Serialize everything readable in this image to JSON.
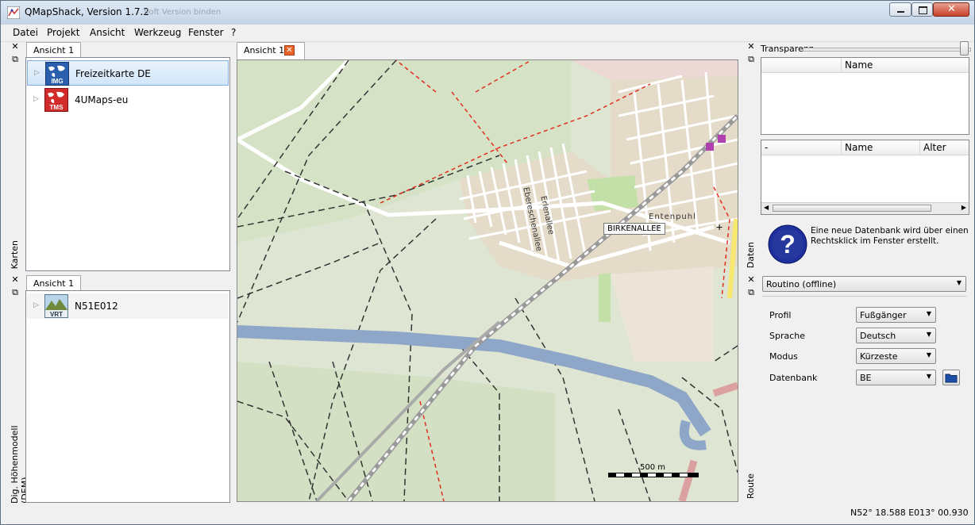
{
  "window": {
    "title": "QMapShack, Version 1.7.2",
    "ghost_title": "Soft Version binden"
  },
  "menu": [
    "Datei",
    "Projekt",
    "Ansicht",
    "Werkzeug",
    "Fenster",
    "?"
  ],
  "left_docks": {
    "maps": {
      "side_label": "Karten",
      "tab": "Ansicht 1",
      "items": [
        {
          "label": "Freizeitkarte DE",
          "badge": "IMG",
          "selected": true
        },
        {
          "label": "4UMaps-eu",
          "badge": "TMS",
          "selected": false
        }
      ]
    },
    "dem": {
      "side_label": "Dig. Höhenmodell (DEM)",
      "tab": "Ansicht 1",
      "items": [
        {
          "label": "N51E012",
          "badge": "VRT"
        }
      ]
    }
  },
  "map": {
    "tab": "Ansicht 1",
    "labels": {
      "street_tooltip": "BIRKENALLEE",
      "place": "Entenpuhl",
      "street1": "Erlenallee",
      "street2": "Ebereschenallee"
    },
    "scale": "500 m"
  },
  "right_docks": {
    "data": {
      "side_label": "Daten",
      "transparency_label": "Transparenz",
      "table1_header": "Name",
      "table2_headers": [
        "-",
        "Name",
        "Alter"
      ],
      "info_text": "Eine neue Datenbank wird über einen Rechtsklick im Fenster erstellt."
    },
    "route": {
      "side_label": "Route",
      "router": "Routino (offline)",
      "fields": [
        {
          "label": "Profil",
          "value": "Fußgänger"
        },
        {
          "label": "Sprache",
          "value": "Deutsch"
        },
        {
          "label": "Modus",
          "value": "Kürzeste"
        },
        {
          "label": "Datenbank",
          "value": "BE"
        }
      ]
    }
  },
  "status": {
    "coordinates": "N52° 18.588 E013° 00.930"
  }
}
